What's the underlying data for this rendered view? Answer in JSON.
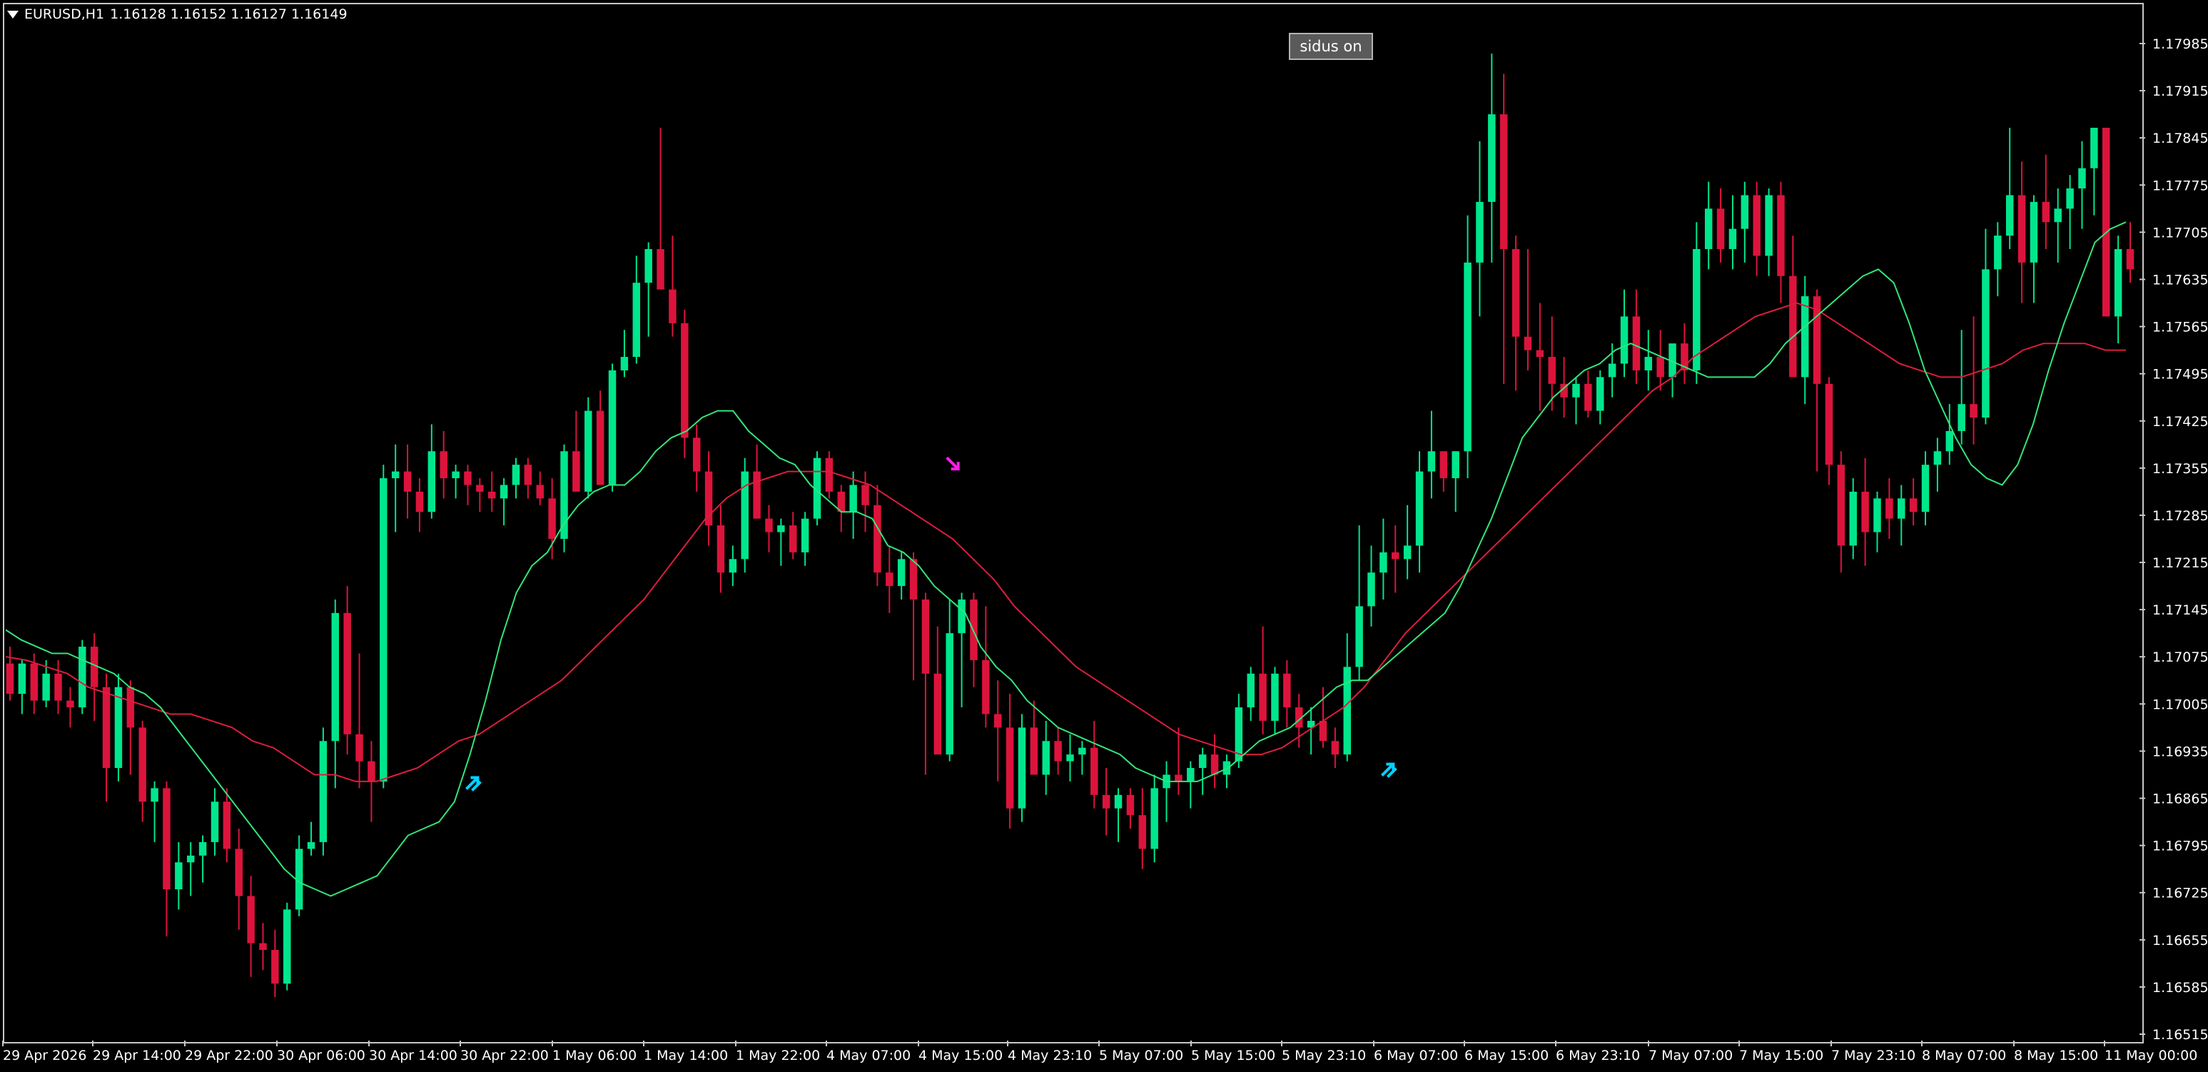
{
  "window": {
    "symbol_label": "EURUSD,H1",
    "ohlc_label": "1.16128 1.16152 1.16127 1.16149"
  },
  "button": {
    "label": "sidus on"
  },
  "colors": {
    "background": "#000000",
    "bull_candle": "#00e68c",
    "bear_candle": "#dc143c",
    "fast_ma": "#32e678",
    "slow_ma": "#dc1e3c",
    "buy_arrow": "#00d2ff",
    "sell_arrow": "#ff1ee6",
    "axis_text": "#ffffff",
    "frame": "#c8c8c8"
  },
  "chart_data": {
    "type": "candlestick",
    "symbol": "EURUSD",
    "timeframe": "H1",
    "ylim": [
      1.1651,
      1.1802
    ],
    "y_ticks": [
      "1.17985",
      "1.17915",
      "1.17845",
      "1.17775",
      "1.17705",
      "1.17635",
      "1.17565",
      "1.17495",
      "1.17425",
      "1.17355",
      "1.17285",
      "1.17215",
      "1.17145",
      "1.17075",
      "1.17005",
      "1.16935",
      "1.16865",
      "1.16795",
      "1.16725",
      "1.16655",
      "1.16585",
      "1.16515"
    ],
    "x_ticks": [
      "29 Apr 2026",
      "29 Apr 14:00",
      "29 Apr 22:00",
      "30 Apr 06:00",
      "30 Apr 14:00",
      "30 Apr 22:00",
      "1 May 06:00",
      "1 May 14:00",
      "1 May 22:00",
      "4 May 07:00",
      "4 May 15:00",
      "4 May 23:10",
      "5 May 07:00",
      "5 May 15:00",
      "5 May 23:10",
      "6 May 07:00",
      "6 May 15:00",
      "6 May 23:10",
      "7 May 07:00",
      "7 May 15:00",
      "7 May 23:10",
      "8 May 07:00",
      "8 May 15:00",
      "11 May 00:00"
    ],
    "candles": [
      [
        1.17065,
        1.1709,
        1.1701,
        1.1702
      ],
      [
        1.1702,
        1.1707,
        1.1699,
        1.17065
      ],
      [
        1.17065,
        1.1708,
        1.1699,
        1.1701
      ],
      [
        1.1701,
        1.1707,
        1.17,
        1.1705
      ],
      [
        1.1705,
        1.1707,
        1.1699,
        1.1701
      ],
      [
        1.1701,
        1.1703,
        1.1697,
        1.17
      ],
      [
        1.17,
        1.171,
        1.1699,
        1.1709
      ],
      [
        1.1709,
        1.1711,
        1.1698,
        1.1703
      ],
      [
        1.1703,
        1.1705,
        1.1686,
        1.1691
      ],
      [
        1.1691,
        1.1705,
        1.1689,
        1.1703
      ],
      [
        1.1703,
        1.1704,
        1.169,
        1.1697
      ],
      [
        1.1697,
        1.1698,
        1.1683,
        1.1686
      ],
      [
        1.1686,
        1.1689,
        1.168,
        1.1688
      ],
      [
        1.1688,
        1.1689,
        1.1666,
        1.1673
      ],
      [
        1.1673,
        1.168,
        1.167,
        1.1677
      ],
      [
        1.1677,
        1.168,
        1.1672,
        1.1678
      ],
      [
        1.1678,
        1.1681,
        1.1674,
        1.168
      ],
      [
        1.168,
        1.1688,
        1.1678,
        1.1686
      ],
      [
        1.1686,
        1.1688,
        1.1677,
        1.1679
      ],
      [
        1.1679,
        1.1682,
        1.1667,
        1.1672
      ],
      [
        1.1672,
        1.1675,
        1.166,
        1.1665
      ],
      [
        1.1665,
        1.1668,
        1.1661,
        1.1664
      ],
      [
        1.1664,
        1.1667,
        1.1657,
        1.1659
      ],
      [
        1.1659,
        1.1671,
        1.1658,
        1.167
      ],
      [
        1.167,
        1.1681,
        1.1669,
        1.1679
      ],
      [
        1.1679,
        1.1683,
        1.1678,
        1.168
      ],
      [
        1.168,
        1.1697,
        1.1678,
        1.1695
      ],
      [
        1.1695,
        1.1716,
        1.1688,
        1.1714
      ],
      [
        1.1714,
        1.1718,
        1.1693,
        1.1696
      ],
      [
        1.1696,
        1.1708,
        1.1688,
        1.1692
      ],
      [
        1.1692,
        1.1695,
        1.1683,
        1.1689
      ],
      [
        1.1689,
        1.1736,
        1.1688,
        1.1734
      ],
      [
        1.1734,
        1.1739,
        1.1726,
        1.1735
      ],
      [
        1.1735,
        1.1739,
        1.1728,
        1.1732
      ],
      [
        1.1732,
        1.1734,
        1.1726,
        1.1729
      ],
      [
        1.1729,
        1.1742,
        1.1728,
        1.1738
      ],
      [
        1.1738,
        1.1741,
        1.1731,
        1.1734
      ],
      [
        1.1734,
        1.1736,
        1.1731,
        1.1735
      ],
      [
        1.1735,
        1.1736,
        1.173,
        1.1733
      ],
      [
        1.1733,
        1.1734,
        1.1729,
        1.1732
      ],
      [
        1.1732,
        1.1735,
        1.1729,
        1.1731
      ],
      [
        1.1731,
        1.1734,
        1.1727,
        1.1733
      ],
      [
        1.1733,
        1.1737,
        1.1731,
        1.1736
      ],
      [
        1.1736,
        1.1737,
        1.1731,
        1.1733
      ],
      [
        1.1733,
        1.1735,
        1.173,
        1.1731
      ],
      [
        1.1731,
        1.1734,
        1.1722,
        1.1725
      ],
      [
        1.1725,
        1.1739,
        1.1723,
        1.1738
      ],
      [
        1.1738,
        1.1744,
        1.1733,
        1.1732
      ],
      [
        1.1732,
        1.1746,
        1.1731,
        1.1744
      ],
      [
        1.1744,
        1.1747,
        1.1736,
        1.1733
      ],
      [
        1.1733,
        1.1751,
        1.1732,
        1.175
      ],
      [
        1.175,
        1.1756,
        1.1749,
        1.1752
      ],
      [
        1.1752,
        1.1767,
        1.1751,
        1.1763
      ],
      [
        1.1763,
        1.1769,
        1.1755,
        1.1768
      ],
      [
        1.1768,
        1.1786,
        1.1765,
        1.1762
      ],
      [
        1.1762,
        1.177,
        1.1755,
        1.1757
      ],
      [
        1.1757,
        1.1759,
        1.1737,
        1.174
      ],
      [
        1.174,
        1.1742,
        1.1732,
        1.1735
      ],
      [
        1.1735,
        1.1738,
        1.1724,
        1.1727
      ],
      [
        1.1727,
        1.173,
        1.1717,
        1.172
      ],
      [
        1.172,
        1.1724,
        1.1718,
        1.1722
      ],
      [
        1.1722,
        1.1737,
        1.172,
        1.1735
      ],
      [
        1.1735,
        1.1739,
        1.1729,
        1.1728
      ],
      [
        1.1728,
        1.173,
        1.1723,
        1.1726
      ],
      [
        1.1726,
        1.1728,
        1.1721,
        1.1727
      ],
      [
        1.1727,
        1.1729,
        1.1722,
        1.1723
      ],
      [
        1.1723,
        1.1729,
        1.1721,
        1.1728
      ],
      [
        1.1728,
        1.1738,
        1.1727,
        1.1737
      ],
      [
        1.1737,
        1.1738,
        1.1731,
        1.1732
      ],
      [
        1.1732,
        1.1733,
        1.1726,
        1.1729
      ],
      [
        1.1729,
        1.1735,
        1.1725,
        1.1733
      ],
      [
        1.1733,
        1.1735,
        1.1726,
        1.173
      ],
      [
        1.173,
        1.1733,
        1.1718,
        1.172
      ],
      [
        1.172,
        1.1724,
        1.1714,
        1.1718
      ],
      [
        1.1718,
        1.1723,
        1.1716,
        1.1722
      ],
      [
        1.1722,
        1.1723,
        1.1704,
        1.1716
      ],
      [
        1.1716,
        1.1717,
        1.169,
        1.1705
      ],
      [
        1.1705,
        1.1712,
        1.1696,
        1.1693
      ],
      [
        1.1693,
        1.1716,
        1.1692,
        1.1711
      ],
      [
        1.1711,
        1.1717,
        1.17,
        1.1716
      ],
      [
        1.1716,
        1.1717,
        1.1703,
        1.1707
      ],
      [
        1.1707,
        1.1715,
        1.1697,
        1.1699
      ],
      [
        1.1699,
        1.1704,
        1.1689,
        1.1697
      ],
      [
        1.1697,
        1.1702,
        1.1682,
        1.1685
      ],
      [
        1.1685,
        1.1699,
        1.1683,
        1.1697
      ],
      [
        1.1697,
        1.1701,
        1.1693,
        1.169
      ],
      [
        1.169,
        1.1698,
        1.1687,
        1.1695
      ],
      [
        1.1695,
        1.1697,
        1.169,
        1.1692
      ],
      [
        1.1692,
        1.1696,
        1.1689,
        1.1693
      ],
      [
        1.1693,
        1.1695,
        1.169,
        1.1694
      ],
      [
        1.1694,
        1.1698,
        1.1685,
        1.1687
      ],
      [
        1.1687,
        1.1691,
        1.1681,
        1.1685
      ],
      [
        1.1685,
        1.1688,
        1.168,
        1.1687
      ],
      [
        1.1687,
        1.1688,
        1.1682,
        1.1684
      ],
      [
        1.1684,
        1.1688,
        1.1676,
        1.1679
      ],
      [
        1.1679,
        1.169,
        1.1677,
        1.1688
      ],
      [
        1.1688,
        1.1692,
        1.1683,
        1.169
      ],
      [
        1.169,
        1.1697,
        1.1687,
        1.1689
      ],
      [
        1.1689,
        1.1692,
        1.1685,
        1.1691
      ],
      [
        1.1691,
        1.1694,
        1.1687,
        1.1693
      ],
      [
        1.1693,
        1.1696,
        1.1688,
        1.169
      ],
      [
        1.169,
        1.1693,
        1.1688,
        1.1692
      ],
      [
        1.1692,
        1.1702,
        1.1691,
        1.17
      ],
      [
        1.17,
        1.1706,
        1.1698,
        1.1705
      ],
      [
        1.1705,
        1.1712,
        1.1696,
        1.1698
      ],
      [
        1.1698,
        1.1706,
        1.1696,
        1.1705
      ],
      [
        1.1705,
        1.1707,
        1.1697,
        1.17
      ],
      [
        1.17,
        1.1702,
        1.1694,
        1.1697
      ],
      [
        1.1697,
        1.17,
        1.1693,
        1.1698
      ],
      [
        1.1698,
        1.1703,
        1.1694,
        1.1695
      ],
      [
        1.1695,
        1.1697,
        1.1691,
        1.1693
      ],
      [
        1.1693,
        1.1711,
        1.1692,
        1.1706
      ],
      [
        1.1706,
        1.1727,
        1.1704,
        1.1715
      ],
      [
        1.1715,
        1.1724,
        1.1712,
        1.172
      ],
      [
        1.172,
        1.1728,
        1.1716,
        1.1723
      ],
      [
        1.1723,
        1.1727,
        1.1717,
        1.1722
      ],
      [
        1.1722,
        1.173,
        1.1719,
        1.1724
      ],
      [
        1.1724,
        1.1738,
        1.172,
        1.1735
      ],
      [
        1.1735,
        1.1744,
        1.1731,
        1.1738
      ],
      [
        1.1738,
        1.1735,
        1.1732,
        1.1734
      ],
      [
        1.1734,
        1.1738,
        1.1729,
        1.1738
      ],
      [
        1.1738,
        1.1773,
        1.1734,
        1.1766
      ],
      [
        1.1766,
        1.1784,
        1.1758,
        1.1775
      ],
      [
        1.1775,
        1.1797,
        1.1766,
        1.1788
      ],
      [
        1.1788,
        1.1794,
        1.1748,
        1.1768
      ],
      [
        1.1768,
        1.177,
        1.1747,
        1.1755
      ],
      [
        1.1755,
        1.1768,
        1.175,
        1.1753
      ],
      [
        1.1753,
        1.176,
        1.1744,
        1.1752
      ],
      [
        1.1752,
        1.1758,
        1.1744,
        1.1748
      ],
      [
        1.1748,
        1.1752,
        1.1743,
        1.1746
      ],
      [
        1.1746,
        1.1749,
        1.1742,
        1.1748
      ],
      [
        1.1748,
        1.175,
        1.1743,
        1.1744
      ],
      [
        1.1744,
        1.175,
        1.1742,
        1.1749
      ],
      [
        1.1749,
        1.1754,
        1.1746,
        1.1751
      ],
      [
        1.1751,
        1.1762,
        1.1749,
        1.1758
      ],
      [
        1.1758,
        1.1762,
        1.1748,
        1.175
      ],
      [
        1.175,
        1.1756,
        1.1747,
        1.1752
      ],
      [
        1.1752,
        1.1756,
        1.1747,
        1.1749
      ],
      [
        1.1749,
        1.1753,
        1.1746,
        1.1754
      ],
      [
        1.1754,
        1.1757,
        1.1748,
        1.175
      ],
      [
        1.175,
        1.1772,
        1.1748,
        1.1768
      ],
      [
        1.1768,
        1.1778,
        1.1765,
        1.1774
      ],
      [
        1.1774,
        1.1777,
        1.1766,
        1.1768
      ],
      [
        1.1768,
        1.1776,
        1.1765,
        1.1771
      ],
      [
        1.1771,
        1.1778,
        1.1766,
        1.1776
      ],
      [
        1.1776,
        1.1778,
        1.1764,
        1.1767
      ],
      [
        1.1767,
        1.1777,
        1.1764,
        1.1776
      ],
      [
        1.1776,
        1.1778,
        1.176,
        1.1764
      ],
      [
        1.1764,
        1.177,
        1.1758,
        1.1749
      ],
      [
        1.1749,
        1.1764,
        1.1745,
        1.1761
      ],
      [
        1.1761,
        1.1762,
        1.1735,
        1.1748
      ],
      [
        1.1748,
        1.1749,
        1.1733,
        1.1736
      ],
      [
        1.1736,
        1.1738,
        1.172,
        1.1724
      ],
      [
        1.1724,
        1.1734,
        1.1722,
        1.1732
      ],
      [
        1.1732,
        1.1737,
        1.1721,
        1.1726
      ],
      [
        1.1726,
        1.1732,
        1.1723,
        1.1731
      ],
      [
        1.1731,
        1.1734,
        1.1725,
        1.1728
      ],
      [
        1.1728,
        1.1733,
        1.1724,
        1.1731
      ],
      [
        1.1731,
        1.1734,
        1.1727,
        1.1729
      ],
      [
        1.1729,
        1.1738,
        1.1727,
        1.1736
      ],
      [
        1.1736,
        1.174,
        1.1732,
        1.1738
      ],
      [
        1.1738,
        1.1745,
        1.1736,
        1.1741
      ],
      [
        1.1741,
        1.1756,
        1.1739,
        1.1745
      ],
      [
        1.1745,
        1.1758,
        1.1739,
        1.1743
      ],
      [
        1.1743,
        1.1771,
        1.1742,
        1.1765
      ],
      [
        1.1765,
        1.1772,
        1.1761,
        1.177
      ],
      [
        1.177,
        1.1786,
        1.1768,
        1.1776
      ],
      [
        1.1776,
        1.1781,
        1.176,
        1.1766
      ],
      [
        1.1766,
        1.1776,
        1.176,
        1.1775
      ],
      [
        1.1775,
        1.1782,
        1.1768,
        1.1772
      ],
      [
        1.1772,
        1.1777,
        1.1766,
        1.1774
      ],
      [
        1.1774,
        1.1779,
        1.1768,
        1.1777
      ],
      [
        1.1777,
        1.1784,
        1.1771,
        1.178
      ],
      [
        1.178,
        1.1786,
        1.1773,
        1.1786
      ],
      [
        1.1786,
        1.1782,
        1.1773,
        1.1758
      ],
      [
        1.1758,
        1.177,
        1.1754,
        1.1768
      ],
      [
        1.1768,
        1.1772,
        1.1763,
        1.1765
      ]
    ],
    "fast_ma": [
      1.17115,
      1.171,
      1.1709,
      1.1708,
      1.1708,
      1.1707,
      1.1706,
      1.1705,
      1.1703,
      1.1702,
      1.17,
      1.1697,
      1.1694,
      1.1691,
      1.1688,
      1.1685,
      1.1682,
      1.1679,
      1.1676,
      1.1674,
      1.1673,
      1.1672,
      1.1673,
      1.1674,
      1.1675,
      1.1678,
      1.1681,
      1.1682,
      1.1683,
      1.1686,
      1.1693,
      1.1701,
      1.171,
      1.1717,
      1.1721,
      1.1723,
      1.1727,
      1.173,
      1.1732,
      1.1733,
      1.1733,
      1.1735,
      1.1738,
      1.174,
      1.1741,
      1.1743,
      1.1744,
      1.1744,
      1.1741,
      1.1739,
      1.1737,
      1.1736,
      1.1733,
      1.1731,
      1.1729,
      1.1729,
      1.1728,
      1.1724,
      1.1723,
      1.1721,
      1.1718,
      1.1716,
      1.1714,
      1.1709,
      1.1706,
      1.1704,
      1.1701,
      1.1699,
      1.1697,
      1.1696,
      1.1695,
      1.1694,
      1.1693,
      1.1691,
      1.169,
      1.1689,
      1.1689,
      1.1689,
      1.169,
      1.1691,
      1.1693,
      1.1695,
      1.1696,
      1.1697,
      1.1699,
      1.1701,
      1.1703,
      1.1704,
      1.1704,
      1.1706,
      1.1708,
      1.171,
      1.1712,
      1.1714,
      1.1718,
      1.1723,
      1.1728,
      1.1734,
      1.174,
      1.1743,
      1.1746,
      1.1748,
      1.175,
      1.1751,
      1.1753,
      1.1754,
      1.1753,
      1.1752,
      1.1751,
      1.175,
      1.1749,
      1.1749,
      1.1749,
      1.1749,
      1.1751,
      1.1754,
      1.1756,
      1.1758,
      1.176,
      1.1762,
      1.1764,
      1.1765,
      1.1763,
      1.1757,
      1.175,
      1.1745,
      1.174,
      1.1736,
      1.1734,
      1.1733,
      1.1736,
      1.1742,
      1.175,
      1.1757,
      1.1763,
      1.1769,
      1.1771,
      1.1772
    ],
    "slow_ma": [
      1.17075,
      1.1707,
      1.1706,
      1.1705,
      1.1703,
      1.1702,
      1.1701,
      1.17,
      1.1699,
      1.1699,
      1.1698,
      1.1697,
      1.1695,
      1.1694,
      1.1692,
      1.169,
      1.169,
      1.1689,
      1.1689,
      1.169,
      1.1691,
      1.1693,
      1.1695,
      1.1696,
      1.1698,
      1.17,
      1.1702,
      1.1704,
      1.1707,
      1.171,
      1.1713,
      1.1716,
      1.172,
      1.1724,
      1.1728,
      1.1731,
      1.1733,
      1.1734,
      1.1735,
      1.1735,
      1.1735,
      1.1734,
      1.1733,
      1.1731,
      1.1729,
      1.1727,
      1.1725,
      1.1722,
      1.1719,
      1.1715,
      1.1712,
      1.1709,
      1.1706,
      1.1704,
      1.1702,
      1.17,
      1.1698,
      1.1696,
      1.1695,
      1.1694,
      1.1693,
      1.1693,
      1.1694,
      1.1696,
      1.1698,
      1.17,
      1.1703,
      1.1707,
      1.1711,
      1.1714,
      1.1717,
      1.172,
      1.1723,
      1.1726,
      1.1729,
      1.1732,
      1.1735,
      1.1738,
      1.1741,
      1.1744,
      1.1747,
      1.1749,
      1.1752,
      1.1754,
      1.1756,
      1.1758,
      1.1759,
      1.176,
      1.1759,
      1.1757,
      1.1755,
      1.1753,
      1.1751,
      1.175,
      1.1749,
      1.1749,
      1.175,
      1.1751,
      1.1753,
      1.1754,
      1.1754,
      1.1754,
      1.1753,
      1.1753
    ],
    "buy_signals": [
      {
        "index": 38,
        "price": 1.169
      },
      {
        "index": 114,
        "price": 1.1692
      }
    ],
    "sell_signals": [
      {
        "index": 78,
        "price": 1.1736
      }
    ]
  }
}
